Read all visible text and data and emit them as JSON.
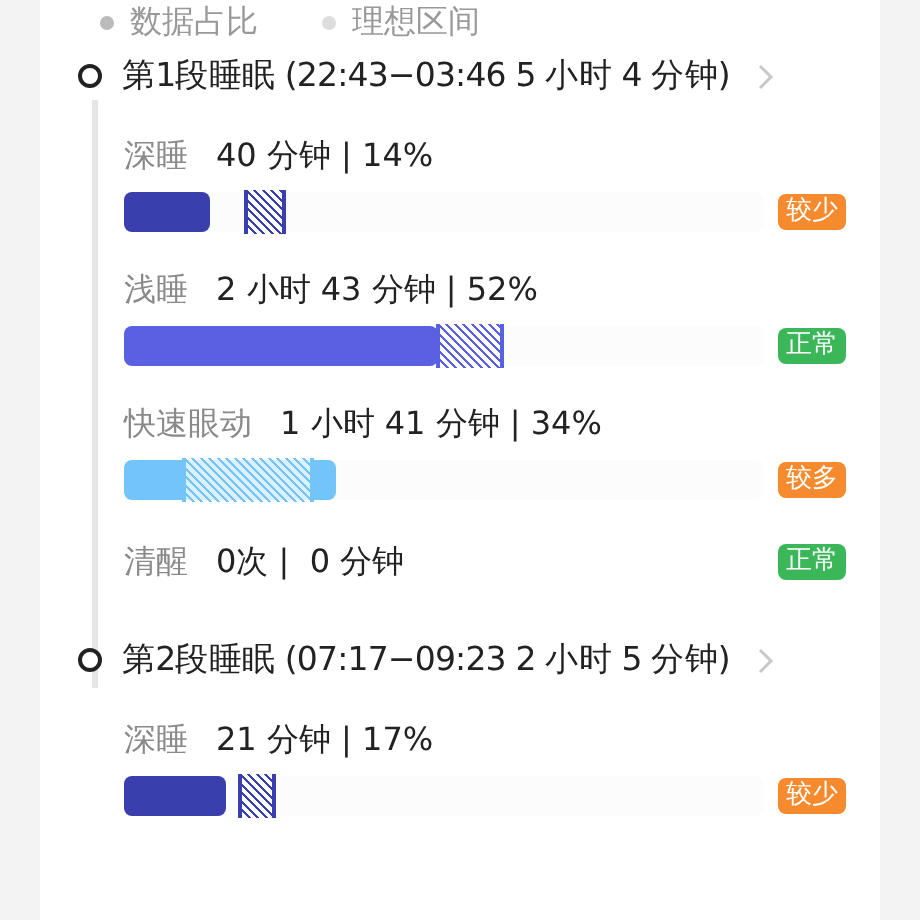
{
  "legend": [
    {
      "label": "数据占比",
      "kind": "data"
    },
    {
      "label": "理想区间",
      "kind": "ideal"
    }
  ],
  "segments": [
    {
      "title": "第1段睡眠 (22:43−03:46  5 小时 4 分钟)",
      "stages": [
        {
          "kind": "deep",
          "name": "深睡",
          "value": "40 分钟 | 14%",
          "level": 0.135,
          "ideal": {
            "start": {
              "level": 0.19
            },
            "end": {
              "level": 0.25
            }
          },
          "tag": {
            "label": "较少",
            "color": "#f58a2e"
          }
        },
        {
          "kind": "light",
          "name": "浅睡",
          "value": "2 小时 43 分钟 | 52%",
          "level": 0.49,
          "ideal": {
            "start": {
              "level": 0.49
            },
            "end": {
              "level": 0.59
            }
          },
          "tag": {
            "label": "正常",
            "color": "#3bb75a"
          }
        },
        {
          "kind": "rem",
          "name": "快速眼动",
          "value": "1 小时 41 分钟 | 34%",
          "level": 0.33,
          "ideal": {
            "start": {
              "level": 0.095
            },
            "end": {
              "level": 0.295
            }
          },
          "tag": {
            "label": "较多",
            "color": "#f58a2e"
          }
        },
        {
          "kind": "awake",
          "name": "清醒",
          "value": "0次 |  0 分钟",
          "tag": {
            "label": "正常",
            "color": "#3bb75a"
          }
        }
      ]
    },
    {
      "title": "第2段睡眠 (07:17−09:23  2 小时 5 分钟)",
      "stages": [
        {
          "kind": "deep",
          "name": "深睡",
          "value": "21 分钟 | 17%",
          "level": 0.16,
          "ideal": {
            "start": {
              "level": 0.18
            },
            "end": {
              "level": 0.235
            }
          },
          "tag": {
            "label": "较少",
            "color": "#f58a2e"
          }
        }
      ]
    }
  ]
}
